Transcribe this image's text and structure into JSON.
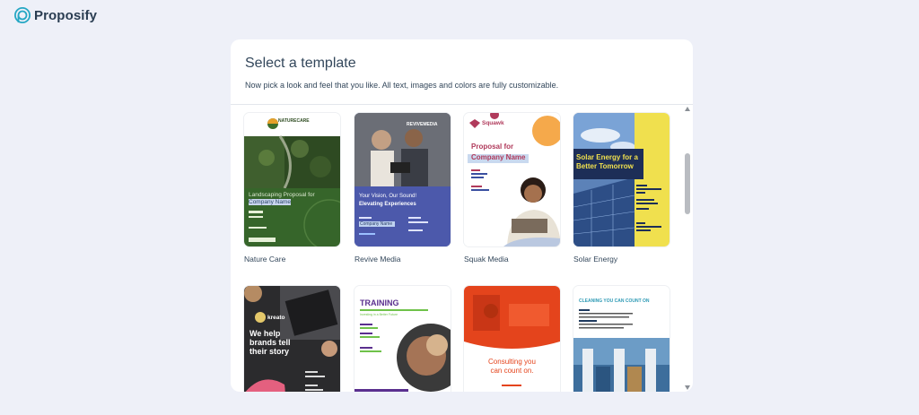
{
  "brand": {
    "name": "Proposify"
  },
  "modal": {
    "title": "Select a template",
    "subtitle": "Now pick a look and feel that you like. All text, images and colors are fully customizable."
  },
  "templates": [
    {
      "name": "Nature Care",
      "preview": {
        "brand": "NATURECARE",
        "tagline": "Landscaping Proposal for",
        "highlight": "Company Name"
      }
    },
    {
      "name": "Revive Media",
      "preview": {
        "brand": "REVIVEMEDIA",
        "line1": "Your Vision, Our Sound!",
        "line2": "Elevating Experiences",
        "highlight": "Company Name"
      }
    },
    {
      "name": "Squak Media",
      "preview": {
        "brand": "Squawk",
        "line1": "Proposal for",
        "highlight": "Company Name"
      }
    },
    {
      "name": "Solar Energy",
      "preview": {
        "line1": "Solar Energy for a",
        "line2": "Better Tomorrow"
      }
    },
    {
      "name": "",
      "preview": {
        "brand": "kreato",
        "line1": "We help",
        "line2": "brands tell",
        "line3": "their story"
      }
    },
    {
      "name": "",
      "preview": {
        "line1": "TRAINING",
        "line2": "Investing in a Better Future"
      }
    },
    {
      "name": "",
      "preview": {
        "line1": "Consulting you",
        "line2": "can count on."
      }
    },
    {
      "name": "",
      "preview": {
        "line1": "CLEANING YOU CAN COUNT ON"
      }
    }
  ]
}
